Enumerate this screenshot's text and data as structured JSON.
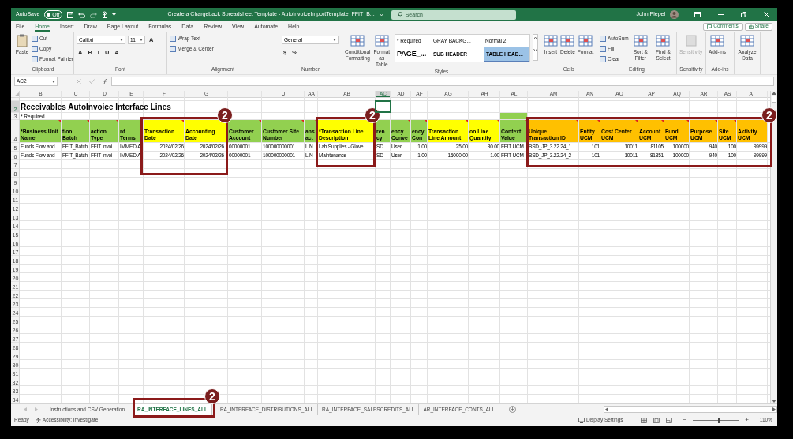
{
  "title_bar": {
    "autosave_label": "AutoSave",
    "autosave": {
      "on": false,
      "label": "Off"
    },
    "title": "Create a Chargeback Spreadsheet Template - AutoInvoiceImportTemplate_FFIT_B...",
    "search_placeholder": "Search",
    "user_name": "John Plepel"
  },
  "menu_tabs": [
    {
      "label": "File",
      "selected": false
    },
    {
      "label": "Home",
      "selected": true
    },
    {
      "label": "Insert",
      "selected": false
    },
    {
      "label": "Draw",
      "selected": false
    },
    {
      "label": "Page Layout",
      "selected": false
    },
    {
      "label": "Formulas",
      "selected": false
    },
    {
      "label": "Data",
      "selected": false
    },
    {
      "label": "Review",
      "selected": false
    },
    {
      "label": "View",
      "selected": false
    },
    {
      "label": "Automate",
      "selected": false
    },
    {
      "label": "Help",
      "selected": false
    }
  ],
  "header_buttons": [
    "Comments",
    "Share"
  ],
  "ribbon": [
    {
      "label": "Clipboard",
      "items": [
        {
          "kind": "big",
          "label": "Paste"
        },
        {
          "kind": "small",
          "label": "Cut"
        },
        {
          "kind": "small",
          "label": "Copy"
        },
        {
          "kind": "small",
          "label": "Format Painter"
        }
      ]
    },
    {
      "label": "Font",
      "items": [
        {
          "kind": "field",
          "value": "Calibri"
        },
        {
          "kind": "field",
          "value": "11"
        },
        {
          "kind": "glyph",
          "label": "A"
        },
        {
          "kind": "glyph",
          "label": "A"
        },
        {
          "kind": "glyph",
          "label": "B"
        },
        {
          "kind": "glyph",
          "label": "I"
        },
        {
          "kind": "glyph",
          "label": "U"
        },
        {
          "kind": "glyph",
          "label": "A"
        }
      ]
    },
    {
      "label": "Alignment",
      "items": [
        {
          "kind": "small",
          "label": "Wrap Text"
        },
        {
          "kind": "small",
          "label": "Merge & Center"
        }
      ]
    },
    {
      "label": "Number",
      "items": [
        {
          "kind": "field",
          "value": "General"
        },
        {
          "kind": "glyph",
          "label": "$"
        },
        {
          "kind": "glyph",
          "label": "%"
        }
      ]
    },
    {
      "label": "Styles",
      "items": [
        {
          "kind": "big",
          "label": "Conditional Formatting"
        },
        {
          "kind": "big",
          "label": "Format as Table"
        }
      ],
      "gallery": [
        {
          "label": "* Required",
          "selected": false
        },
        {
          "label": "GRAY BACKG...",
          "selected": false
        },
        {
          "label": "Normal 2",
          "selected": false
        },
        {
          "label": "PAGE_...",
          "selected": false
        },
        {
          "label": "SUB HEADER",
          "selected": false
        },
        {
          "label": "TABLE HEAD...",
          "selected": true
        }
      ]
    },
    {
      "label": "Cells",
      "items": [
        {
          "kind": "big",
          "label": "Insert"
        },
        {
          "kind": "big",
          "label": "Delete"
        },
        {
          "kind": "big",
          "label": "Format"
        }
      ]
    },
    {
      "label": "Editing",
      "items": [
        {
          "kind": "small",
          "label": "AutoSum"
        },
        {
          "kind": "small",
          "label": "Fill"
        },
        {
          "kind": "small",
          "label": "Clear"
        },
        {
          "kind": "big",
          "label": "Sort & Filter"
        },
        {
          "kind": "big",
          "label": "Find & Select"
        }
      ]
    },
    {
      "label": "Sensitivity",
      "items": [
        {
          "kind": "big",
          "label": "Sensitivity",
          "disabled": true
        }
      ]
    },
    {
      "label": "Add-ins",
      "items": [
        {
          "kind": "big",
          "label": "Add-ins"
        }
      ]
    },
    {
      "items": [
        {
          "kind": "big",
          "label": "Analyze Data"
        }
      ]
    }
  ],
  "name_box": "AC2",
  "columns": [
    {
      "label": "B",
      "selected": false
    },
    {
      "label": "C",
      "selected": false
    },
    {
      "label": "D",
      "selected": false
    },
    {
      "label": "E",
      "selected": false
    },
    {
      "label": "F",
      "selected": false
    },
    {
      "label": "G",
      "selected": false
    },
    {
      "label": "T",
      "selected": false
    },
    {
      "label": "U",
      "selected": false
    },
    {
      "label": "AA",
      "selected": false
    },
    {
      "label": "AB",
      "selected": false
    },
    {
      "label": "AC",
      "selected": true
    },
    {
      "label": "AD",
      "selected": false
    },
    {
      "label": "AF",
      "selected": false
    },
    {
      "label": "AG",
      "selected": false
    },
    {
      "label": "AH",
      "selected": false
    },
    {
      "label": "AL",
      "selected": false
    },
    {
      "label": "AM",
      "selected": false
    },
    {
      "label": "AN",
      "selected": false
    },
    {
      "label": "AO",
      "selected": false
    },
    {
      "label": "AP",
      "selected": false
    },
    {
      "label": "AQ",
      "selected": false
    },
    {
      "label": "AR",
      "selected": false
    },
    {
      "label": "AS",
      "selected": false
    },
    {
      "label": "AT",
      "selected": false
    }
  ],
  "rows": [
    {
      "number": "2",
      "kind": "title",
      "selected": true,
      "cells": {
        "B": {
          "text": "Receivables AutoInvoice Interface Lines"
        }
      }
    },
    {
      "number": "3",
      "kind": "note",
      "selected": false,
      "cells": {
        "B": {
          "text": "* Required"
        },
        "AL": {
          "color": "#92d050"
        }
      }
    },
    {
      "number": "4",
      "kind": "header",
      "selected": false,
      "cells": {
        "B": {
          "text": "*Business Unit Name",
          "color": "#92d050"
        },
        "C": {
          "text": "tion Batch",
          "color": "#92d050"
        },
        "D": {
          "text": "action Type",
          "color": "#92d050"
        },
        "E": {
          "text": "nt Terms",
          "color": "#92d050"
        },
        "F": {
          "text": "Transaction Date",
          "color": "#ffff00"
        },
        "G": {
          "text": "Accounting Date",
          "color": "#ffff00"
        },
        "T": {
          "text": "Customer Account",
          "color": "#92d050"
        },
        "U": {
          "text": "Customer Site Number",
          "color": "#92d050"
        },
        "AA": {
          "text": "ans act",
          "color": "#92d050"
        },
        "AB": {
          "text": "*Transaction Line Description",
          "color": "#ffff00"
        },
        "AC": {
          "text": "ren cy",
          "color": "#92d050"
        },
        "AD": {
          "text": "ency Conve",
          "color": "#92d050"
        },
        "AF": {
          "text": "ency Con",
          "color": "#92d050"
        },
        "AG": {
          "text": "Transaction Line Amount",
          "color": "#ffff00"
        },
        "AH": {
          "text": "on Line Quantity",
          "color": "#ffff00"
        },
        "AL": {
          "text": "Context Value",
          "color": "#92d050"
        },
        "AM": {
          "text": "Unique Transaction ID",
          "color": "#ffc000"
        },
        "AN": {
          "text": "Entity UCM",
          "color": "#ffc000"
        },
        "AO": {
          "text": "Cost Center UCM",
          "color": "#ffc000"
        },
        "AP": {
          "text": "Account UCM",
          "color": "#ffc000"
        },
        "AQ": {
          "text": "Fund UCM",
          "color": "#ffc000"
        },
        "AR": {
          "text": "Purpose UCM",
          "color": "#ffc000"
        },
        "AS": {
          "text": "Site UCM",
          "color": "#ffc000"
        },
        "AT": {
          "text": "Activity UCM",
          "color": "#ffc000"
        }
      }
    },
    {
      "number": "5",
      "kind": "data",
      "selected": false,
      "cells": {
        "B": {
          "text": "Funds Flow and"
        },
        "C": {
          "text": "FFIT_Batch"
        },
        "D": {
          "text": "FFIT Invoi"
        },
        "E": {
          "text": "IMMEDIA"
        },
        "F": {
          "text": "2024/02/26"
        },
        "G": {
          "text": "2024/02/26"
        },
        "T": {
          "text": "00000001"
        },
        "U": {
          "text": "100000000001"
        },
        "AA": {
          "text": "LIN"
        },
        "AB": {
          "text": "Lab Supplies - Glove"
        },
        "AC": {
          "text": "SD"
        },
        "AD": {
          "text": "User"
        },
        "AF": {
          "text": "1.00"
        },
        "AG": {
          "text": "25.00"
        },
        "AH": {
          "text": "30.00"
        },
        "AL": {
          "text": "FFIT UCM"
        },
        "AM": {
          "text": "BSD_JP_3.22.24_1"
        },
        "AN": {
          "text": "101"
        },
        "AO": {
          "text": "10011"
        },
        "AP": {
          "text": "81105"
        },
        "AQ": {
          "text": "100000"
        },
        "AR": {
          "text": "940"
        },
        "AS": {
          "text": "100"
        },
        "AT": {
          "text": "99999"
        }
      }
    },
    {
      "number": "6",
      "kind": "data",
      "selected": false,
      "cells": {
        "B": {
          "text": "Funds Flow and"
        },
        "C": {
          "text": "FFIT_Batch"
        },
        "D": {
          "text": "FFIT Invoi"
        },
        "E": {
          "text": "IMMEDIA"
        },
        "F": {
          "text": "2024/02/26"
        },
        "G": {
          "text": "2024/02/26"
        },
        "T": {
          "text": "00000001"
        },
        "U": {
          "text": "100000000001"
        },
        "AA": {
          "text": "LIN"
        },
        "AB": {
          "text": "Maintenance"
        },
        "AC": {
          "text": "SD"
        },
        "AD": {
          "text": "User"
        },
        "AF": {
          "text": "1.00"
        },
        "AG": {
          "text": "15000.00"
        },
        "AH": {
          "text": "1.00"
        },
        "AL": {
          "text": "FFIT UCM"
        },
        "AM": {
          "text": "BSD_JP_3.22.24_2"
        },
        "AN": {
          "text": "101"
        },
        "AO": {
          "text": "10011"
        },
        "AP": {
          "text": "81851"
        },
        "AQ": {
          "text": "100000"
        },
        "AR": {
          "text": "940"
        },
        "AS": {
          "text": "100"
        },
        "AT": {
          "text": "99999"
        }
      }
    },
    {
      "number": "7",
      "selected": false
    },
    {
      "number": "8",
      "selected": false
    },
    {
      "number": "9",
      "selected": false
    },
    {
      "number": "10",
      "selected": false
    },
    {
      "number": "11",
      "selected": false
    },
    {
      "number": "12",
      "selected": false
    },
    {
      "number": "13",
      "selected": false
    },
    {
      "number": "14",
      "selected": false
    },
    {
      "number": "15",
      "selected": false
    },
    {
      "number": "16",
      "selected": false
    },
    {
      "number": "17",
      "selected": false
    },
    {
      "number": "18",
      "selected": false
    },
    {
      "number": "19",
      "selected": false
    },
    {
      "number": "20",
      "selected": false
    },
    {
      "number": "21",
      "selected": false
    },
    {
      "number": "22",
      "selected": false
    },
    {
      "number": "23",
      "selected": false
    },
    {
      "number": "24",
      "selected": false
    },
    {
      "number": "25",
      "selected": false
    },
    {
      "number": "26",
      "selected": false
    },
    {
      "number": "27",
      "selected": false
    },
    {
      "number": "28",
      "selected": false
    },
    {
      "number": "29",
      "selected": false
    },
    {
      "number": "30",
      "selected": false
    },
    {
      "number": "31",
      "selected": false
    },
    {
      "number": "32",
      "selected": false
    },
    {
      "number": "33",
      "selected": false
    },
    {
      "number": "34",
      "selected": false
    }
  ],
  "sheet_tabs": [
    {
      "label": "Instructions and CSV Generation",
      "selected": false
    },
    {
      "label": "RA_INTERFACE_LINES_ALL",
      "selected": true
    },
    {
      "label": "RA_INTERFACE_DISTRIBUTIONS_ALL",
      "selected": false
    },
    {
      "label": "RA_INTERFACE_SALESCREDITS_ALL",
      "selected": false
    },
    {
      "label": "AR_INTERFACE_CONTS_ALL",
      "selected": false
    }
  ],
  "status_bar": {
    "ready": "Ready",
    "accessibility": "Accessibility: Investigate",
    "display_settings": "Display Settings",
    "zoom_out": "−",
    "zoom_in": "+",
    "zoom": {
      "level": 0.55
    },
    "zoom_label": "110%"
  },
  "callouts": [
    {
      "label": "2"
    },
    {
      "label": "2"
    },
    {
      "label": "2"
    },
    {
      "label": "2"
    }
  ]
}
